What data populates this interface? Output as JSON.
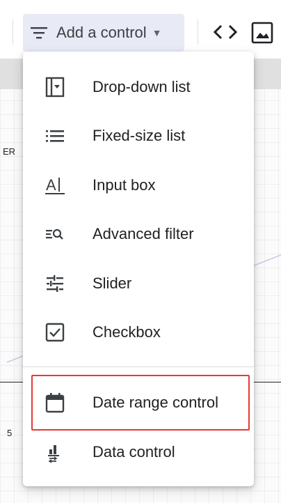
{
  "toolbar": {
    "add_control_label": "Add a control"
  },
  "canvas": {
    "label_er": "ER",
    "label_5": "5"
  },
  "menu": {
    "items": [
      {
        "label": "Drop-down list",
        "icon": "drop-down-list-icon"
      },
      {
        "label": "Fixed-size list",
        "icon": "fixed-size-list-icon"
      },
      {
        "label": "Input box",
        "icon": "input-box-icon"
      },
      {
        "label": "Advanced filter",
        "icon": "advanced-filter-icon"
      },
      {
        "label": "Slider",
        "icon": "slider-icon"
      },
      {
        "label": "Checkbox",
        "icon": "checkbox-icon"
      },
      {
        "label": "Date range control",
        "icon": "calendar-icon",
        "highlighted": true
      },
      {
        "label": "Data control",
        "icon": "data-control-icon"
      }
    ]
  },
  "colors": {
    "highlight": "#e53935",
    "button_bg": "#e8eaf6",
    "icon": "#3c4043"
  }
}
